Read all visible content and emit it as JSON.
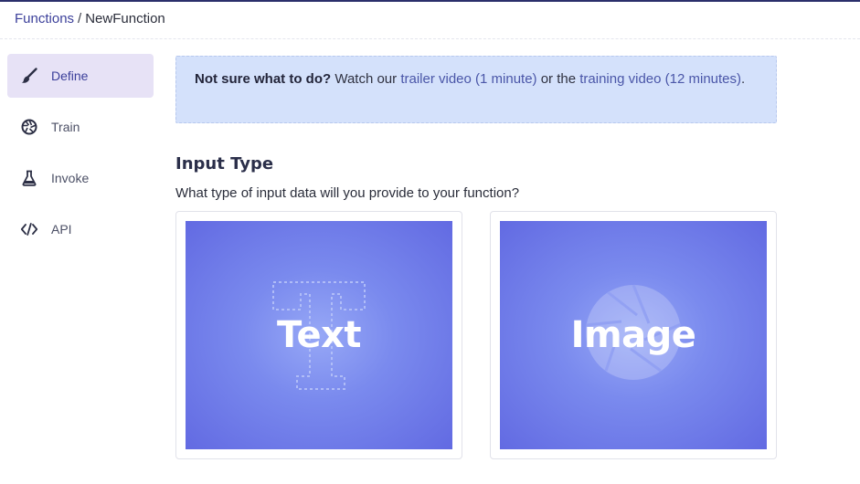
{
  "breadcrumb": {
    "parent": "Functions",
    "separator": "/",
    "current": "NewFunction"
  },
  "sidebar": {
    "items": [
      {
        "label": "Define",
        "icon": "brush-icon",
        "active": true
      },
      {
        "label": "Train",
        "icon": "aperture-icon",
        "active": false
      },
      {
        "label": "Invoke",
        "icon": "flask-icon",
        "active": false
      },
      {
        "label": "API",
        "icon": "code-icon",
        "active": false
      }
    ]
  },
  "banner": {
    "bold": "Not sure what to do?",
    "text1": " Watch our ",
    "link1": "trailer video (1 minute)",
    "text2": " or the ",
    "link2": "training video (12 minutes)",
    "text3": "."
  },
  "section": {
    "title": "Input Type",
    "subtitle": "What type of input data will you provide to your function?"
  },
  "cards": [
    {
      "label": "Text",
      "icon": "text-t-icon"
    },
    {
      "label": "Image",
      "icon": "camera-aperture-icon"
    }
  ],
  "colors": {
    "accent": "#3b3f9a",
    "sidebar_active_bg": "#e7e2f6",
    "banner_bg": "#d4e1fb",
    "card_bg": "#626ae2"
  }
}
